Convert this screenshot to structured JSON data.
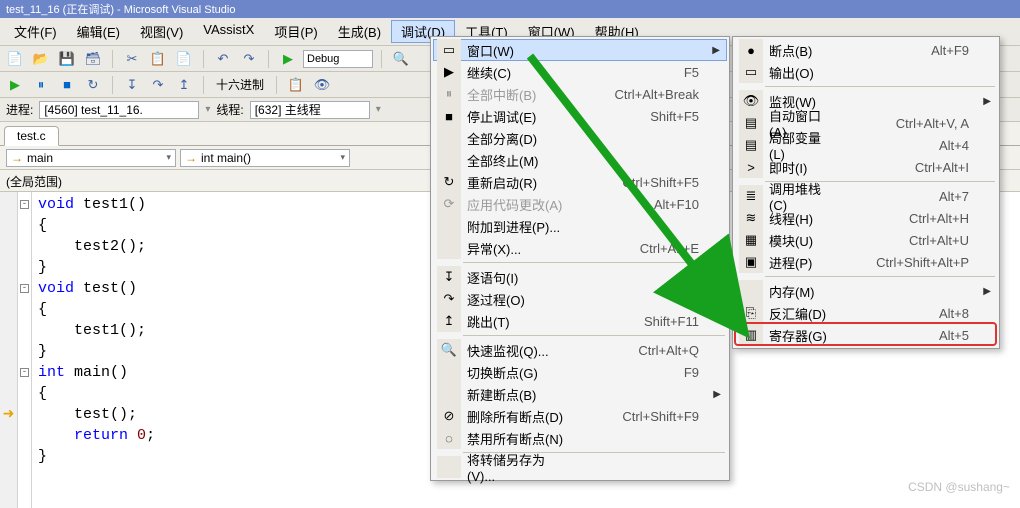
{
  "window": {
    "title": "test_11_16 (正在调试) - Microsoft Visual Studio"
  },
  "menus": {
    "items": [
      "文件(F)",
      "编辑(E)",
      "视图(V)",
      "VAssistX",
      "项目(P)",
      "生成(B)",
      "调试(D)",
      "工具(T)",
      "窗口(W)",
      "帮助(H)"
    ],
    "open_index": 6
  },
  "toolbar": {
    "config": "Debug",
    "hex_label": "十六进制"
  },
  "process": {
    "proc_label": "进程:",
    "proc_value": "[4560] test_11_16.",
    "thread_label": "线程:",
    "thread_value": "[632] 主线程"
  },
  "tab": {
    "name": "test.c"
  },
  "nav": {
    "scope_icon": "→",
    "scope": "main",
    "func": "int main()"
  },
  "scope": "(全局范围)",
  "code_lines": [
    {
      "fold": "-",
      "txt": "void test1()",
      "kw": "void",
      "rest": " test1()"
    },
    {
      "txt": "{"
    },
    {
      "txt": "    test2();"
    },
    {
      "txt": "}"
    },
    {
      "fold": "-",
      "txt": "void test()",
      "kw": "void",
      "rest": " test()"
    },
    {
      "txt": "{"
    },
    {
      "txt": "    test1();"
    },
    {
      "txt": "}"
    },
    {
      "fold": "-",
      "txt": "int main()",
      "kw": "int",
      "rest": " main()"
    },
    {
      "txt": "{"
    },
    {
      "ptr": true,
      "txt": "    test();"
    },
    {
      "txt": "    return 0;",
      "kw": "return",
      "num": "0"
    },
    {
      "txt": "}"
    }
  ],
  "debug_menu": [
    {
      "label": "窗口(W)",
      "sub": true,
      "hover": true,
      "icon": "▭"
    },
    {
      "label": "继续(C)",
      "sc": "F5",
      "icon": "▶"
    },
    {
      "label": "全部中断(B)",
      "sc": "Ctrl+Alt+Break",
      "disabled": true,
      "icon": "⏸"
    },
    {
      "label": "停止调试(E)",
      "sc": "Shift+F5",
      "icon": "■"
    },
    {
      "label": "全部分离(D)"
    },
    {
      "label": "全部终止(M)"
    },
    {
      "label": "重新启动(R)",
      "sc": "Ctrl+Shift+F5",
      "icon": "↻"
    },
    {
      "label": "应用代码更改(A)",
      "sc": "Alt+F10",
      "disabled": true,
      "icon": "⟳"
    },
    {
      "label": "附加到进程(P)..."
    },
    {
      "label": "异常(X)...",
      "sc": "Ctrl+Alt+E"
    },
    {
      "sep": true
    },
    {
      "label": "逐语句(I)",
      "sc": "F11",
      "icon": "↧"
    },
    {
      "label": "逐过程(O)",
      "sc": "F10",
      "icon": "↷"
    },
    {
      "label": "跳出(T)",
      "sc": "Shift+F11",
      "icon": "↥"
    },
    {
      "sep": true
    },
    {
      "label": "快速监视(Q)...",
      "sc": "Ctrl+Alt+Q",
      "icon": "🔍"
    },
    {
      "label": "切换断点(G)",
      "sc": "F9"
    },
    {
      "label": "新建断点(B)",
      "sub": true
    },
    {
      "label": "删除所有断点(D)",
      "sc": "Ctrl+Shift+F9",
      "icon": "⊘"
    },
    {
      "label": "禁用所有断点(N)",
      "icon": "◌"
    },
    {
      "sep": true
    },
    {
      "label": "将转储另存为(V)..."
    }
  ],
  "windows_menu": [
    {
      "label": "断点(B)",
      "sc": "Alt+F9",
      "icon": "●"
    },
    {
      "label": "输出(O)",
      "icon": "▭"
    },
    {
      "sep": true
    },
    {
      "label": "监视(W)",
      "sub": true,
      "icon": "👁"
    },
    {
      "label": "自动窗口(A)",
      "sc": "Ctrl+Alt+V, A",
      "icon": "▤"
    },
    {
      "label": "局部变量(L)",
      "sc": "Alt+4",
      "icon": "▤"
    },
    {
      "label": "即时(I)",
      "sc": "Ctrl+Alt+I",
      "icon": ">"
    },
    {
      "sep": true
    },
    {
      "label": "调用堆栈(C)",
      "sc": "Alt+7",
      "icon": "≣"
    },
    {
      "label": "线程(H)",
      "sc": "Ctrl+Alt+H",
      "icon": "≋"
    },
    {
      "label": "模块(U)",
      "sc": "Ctrl+Alt+U",
      "icon": "▦"
    },
    {
      "label": "进程(P)",
      "sc": "Ctrl+Shift+Alt+P",
      "icon": "▣"
    },
    {
      "sep": true
    },
    {
      "label": "内存(M)",
      "sub": true
    },
    {
      "label": "反汇编(D)",
      "sc": "Alt+8",
      "icon": "⎘"
    },
    {
      "label": "寄存器(G)",
      "sc": "Alt+5",
      "icon": "▥",
      "highlight": true
    }
  ],
  "watermark": "CSDN @sushang~"
}
